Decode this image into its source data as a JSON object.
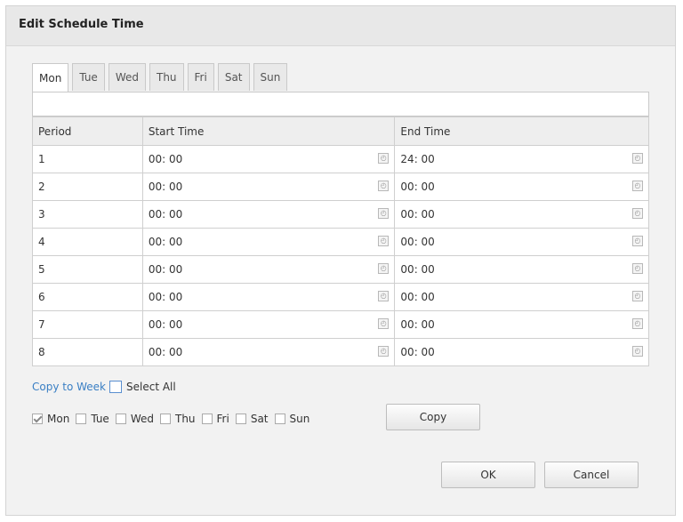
{
  "dialog": {
    "title": "Edit Schedule Time"
  },
  "tabs": [
    "Mon",
    "Tue",
    "Wed",
    "Thu",
    "Fri",
    "Sat",
    "Sun"
  ],
  "table": {
    "headers": {
      "period": "Period",
      "start": "Start Time",
      "end": "End Time"
    },
    "rows": [
      {
        "period": "1",
        "start": "00: 00",
        "end": "24: 00"
      },
      {
        "period": "2",
        "start": "00: 00",
        "end": "00: 00"
      },
      {
        "period": "3",
        "start": "00: 00",
        "end": "00: 00"
      },
      {
        "period": "4",
        "start": "00: 00",
        "end": "00: 00"
      },
      {
        "period": "5",
        "start": "00: 00",
        "end": "00: 00"
      },
      {
        "period": "6",
        "start": "00: 00",
        "end": "00: 00"
      },
      {
        "period": "7",
        "start": "00: 00",
        "end": "00: 00"
      },
      {
        "period": "8",
        "start": "00: 00",
        "end": "00: 00"
      }
    ]
  },
  "copy": {
    "link_label": "Copy to Week",
    "select_all_label": "Select All",
    "days": [
      {
        "label": "Mon",
        "checked": true
      },
      {
        "label": "Tue",
        "checked": false
      },
      {
        "label": "Wed",
        "checked": false
      },
      {
        "label": "Thu",
        "checked": false
      },
      {
        "label": "Fri",
        "checked": false
      },
      {
        "label": "Sat",
        "checked": false
      },
      {
        "label": "Sun",
        "checked": false
      }
    ],
    "copy_button": "Copy"
  },
  "buttons": {
    "ok": "OK",
    "cancel": "Cancel"
  },
  "colors": {
    "link": "#3a7fc4",
    "checkbox_highlight": "#5a8fd0"
  }
}
